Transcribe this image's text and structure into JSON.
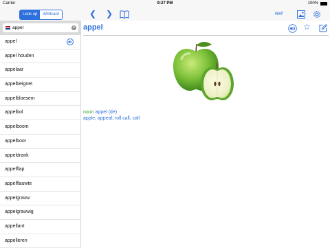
{
  "status_bar": {
    "carrier": "Carrier",
    "time": "9:27 PM",
    "battery": "100%"
  },
  "toolbar": {
    "segment": [
      "Look up",
      "Wildcard"
    ],
    "active_segment": 0,
    "ref_label": "Ref",
    "accent_color": "#2d6fdd"
  },
  "search": {
    "value": "appel",
    "flag": "netherlands-flag"
  },
  "word_list": [
    "appel",
    "appel houden",
    "appelaar",
    "appelbeignet",
    "appelbloesem",
    "appelbol",
    "appelboom",
    "appelboor",
    "appeldrank",
    "appelflap",
    "appelflauwte",
    "appelgrauw",
    "appelgrauwig",
    "appellant",
    "appelleren"
  ],
  "entry": {
    "headword": "appel",
    "part_of_speech": "noun",
    "lemma": "appel (de)",
    "translation": "apple; appeal; roll call, call",
    "image": "green-apples"
  }
}
